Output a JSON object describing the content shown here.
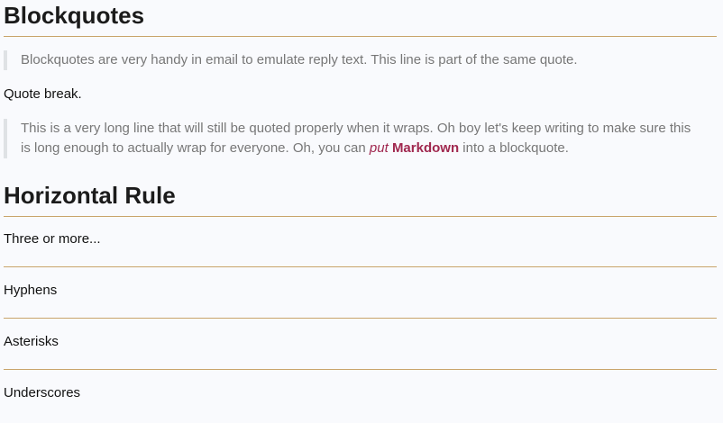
{
  "blockquotes": {
    "heading": "Blockquotes",
    "quote1": "Blockquotes are very handy in email to emulate reply text. This line is part of the same quote.",
    "quote_break": "Quote break.",
    "quote2_text_before": "This is a very long line that will still be quoted properly when it wraps. Oh boy let's keep writing to make sure this is long enough to actually wrap for everyone. Oh, you can ",
    "quote2_em": "put",
    "quote2_space": " ",
    "quote2_strong": "Markdown",
    "quote2_text_after": " into a blockquote."
  },
  "horizontal_rule": {
    "heading": "Horizontal Rule",
    "three_or_more": "Three or more...",
    "hyphens": "Hyphens",
    "asterisks": "Asterisks",
    "underscores": "Underscores"
  },
  "colors": {
    "background": "#f9fafd",
    "rule": "#c9a46b",
    "quote_border": "#dfe2e5",
    "quote_text": "#777777",
    "accent": "#a0284f"
  }
}
